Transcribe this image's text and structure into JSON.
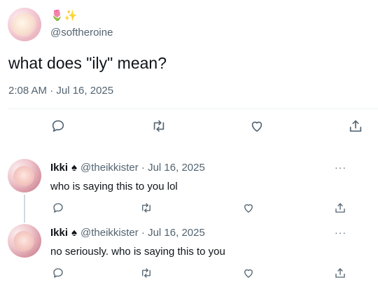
{
  "tweet": {
    "display_emoji": "🌷✨",
    "handle": "@softheroine",
    "text": "what does \"ily\" mean?",
    "timestamp": "2:08 AM · Jul 16, 2025"
  },
  "replies": [
    {
      "name": "Ikki",
      "badge_glyph": "♠",
      "handle_date": "@theikkister · Jul 16, 2025",
      "text": "who is saying this to you lol",
      "more": "···"
    },
    {
      "name": "Ikki",
      "badge_glyph": "♠",
      "handle_date": "@theikkister · Jul 16, 2025",
      "text": "no seriously. who is saying this to you",
      "more": "···"
    }
  ],
  "icons": {
    "reply": "reply-icon",
    "retweet": "retweet-icon",
    "like": "heart-icon",
    "share": "share-icon"
  },
  "colors": {
    "text": "#0f1419",
    "secondary": "#536471",
    "divider": "#eff3f4"
  }
}
